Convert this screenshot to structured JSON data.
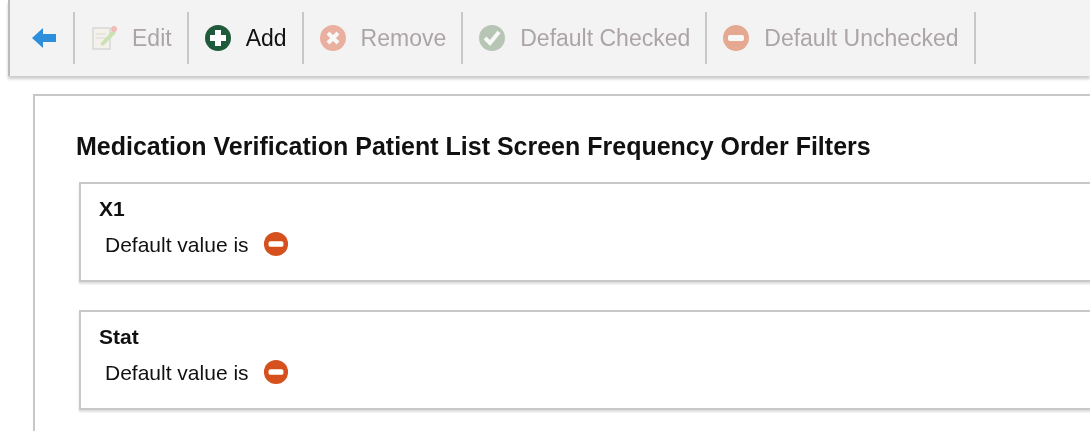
{
  "toolbar": [
    {
      "kind": "back",
      "disabled": false
    },
    {
      "kind": "edit",
      "label": "Edit",
      "disabled": true
    },
    {
      "kind": "add",
      "label": "Add",
      "disabled": false
    },
    {
      "kind": "remove",
      "label": "Remove",
      "disabled": true
    },
    {
      "kind": "check",
      "label": "Default Checked",
      "disabled": true
    },
    {
      "kind": "uncheck",
      "label": "Default Unchecked",
      "disabled": true
    }
  ],
  "panel": {
    "title": "Medication Verification Patient List Screen Frequency Order Filters",
    "filters": [
      {
        "name": "X1",
        "caption": "Default value is",
        "default_checked": false
      },
      {
        "name": "Stat",
        "caption": "Default value is",
        "default_checked": false
      }
    ]
  }
}
